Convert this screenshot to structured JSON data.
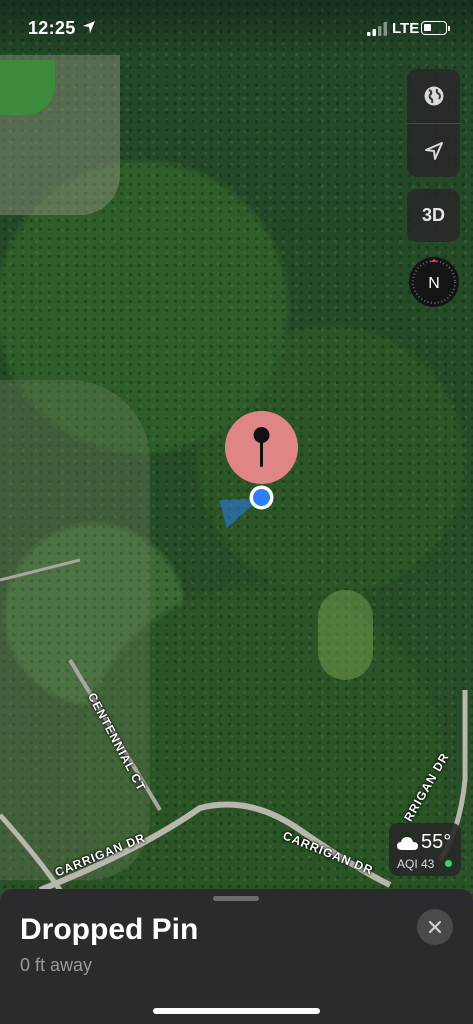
{
  "status_bar": {
    "time": "12:25",
    "network": "LTE",
    "battery_level": 0.35
  },
  "map": {
    "controls": {
      "globe": "globe-icon",
      "locate": "location-arrow-icon",
      "threed_label": "3D",
      "compass_label": "N"
    },
    "road_labels": [
      {
        "id": "centennial",
        "text": "CENTENNIAL CT"
      },
      {
        "id": "carrigan_left",
        "text": "CARRIGAN DR"
      },
      {
        "id": "carrigan_mid",
        "text": "CARRIGAN DR"
      },
      {
        "id": "carrigan_right",
        "text": "RRIGAN DR"
      }
    ],
    "weather": {
      "icon": "cloud-icon",
      "temp": "55°",
      "aqi": "AQI 43",
      "aqi_color": "#3ed16a"
    },
    "pin_color": "#e08585",
    "user_location_color": "#2b7fff"
  },
  "sheet": {
    "title": "Dropped Pin",
    "subtitle": "0 ft away",
    "close_icon": "close-icon"
  }
}
